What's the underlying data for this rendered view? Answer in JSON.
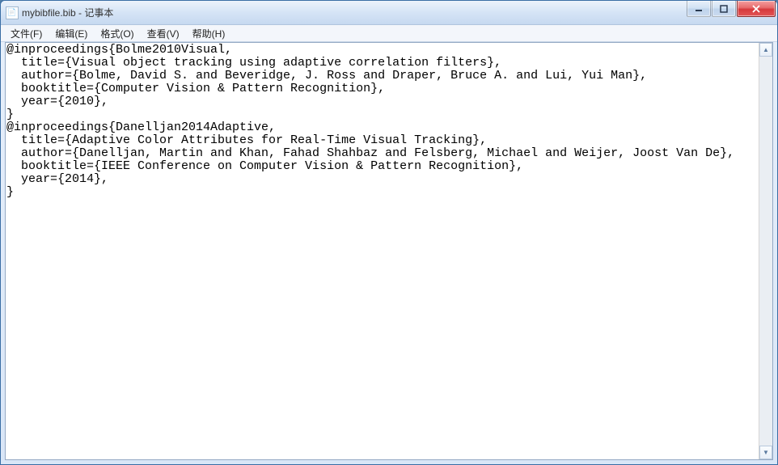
{
  "title": "mybibfile.bib - 记事本",
  "menus": {
    "file": "文件(F)",
    "edit": "编辑(E)",
    "format": "格式(O)",
    "view": "查看(V)",
    "help": "帮助(H)"
  },
  "content": "@inproceedings{Bolme2010Visual,\n  title={Visual object tracking using adaptive correlation filters},\n  author={Bolme, David S. and Beveridge, J. Ross and Draper, Bruce A. and Lui, Yui Man},\n  booktitle={Computer Vision & Pattern Recognition},\n  year={2010},\n}\n@inproceedings{Danelljan2014Adaptive,\n  title={Adaptive Color Attributes for Real-Time Visual Tracking},\n  author={Danelljan, Martin and Khan, Fahad Shahbaz and Felsberg, Michael and Weijer, Joost Van De},\n  booktitle={IEEE Conference on Computer Vision & Pattern Recognition},\n  year={2014},\n}"
}
